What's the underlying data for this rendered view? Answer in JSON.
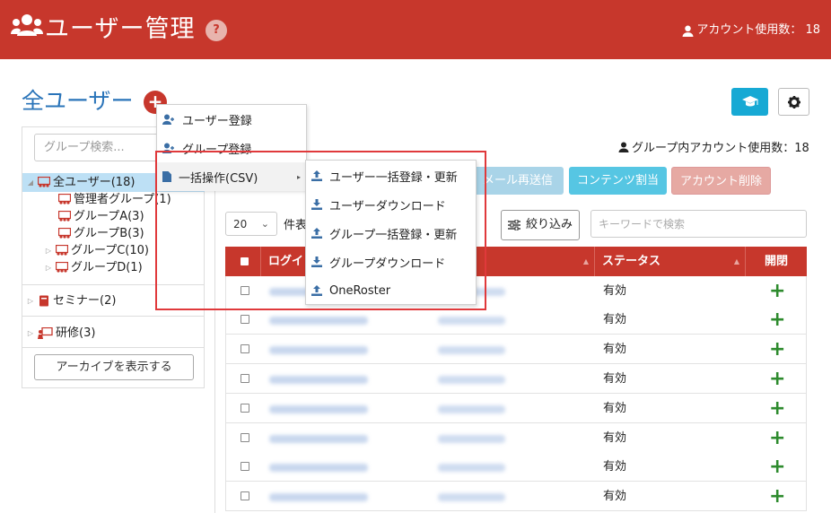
{
  "header": {
    "title": "ユーザー管理",
    "help": "?",
    "account_usage": "アカウント使用数： 18"
  },
  "page": {
    "title": "全ユーザー",
    "add": "+"
  },
  "sidebar": {
    "search_placeholder": "グループ検索...",
    "tree": [
      {
        "label": "全ユーザー(18)",
        "arrow": "◢",
        "selected": true
      },
      {
        "label": "管理者グループ(1)"
      },
      {
        "label": "グループA(3)"
      },
      {
        "label": "グループB(3)"
      },
      {
        "label": "グループC(10)",
        "arrow": "▷"
      },
      {
        "label": "グループD(1)",
        "arrow": "▷"
      }
    ],
    "seminar": "セミナー(2)",
    "training": "研修(3)",
    "archive_button": "アーカイブを表示する",
    "collapsed_arrow": "▷"
  },
  "main": {
    "group_account_usage": "グループ内アカウント使用数：18",
    "buttons": {
      "mail_resend": "メール再送信",
      "content_assign": "コンテンツ割当",
      "account_delete": "アカウント削除"
    },
    "per_page_value": "20",
    "per_page_label": "件表",
    "filter_button": "絞り込み",
    "keyword_placeholder": "キーワードで検索"
  },
  "table": {
    "headers": {
      "login": "ログイ",
      "status": "ステータス",
      "open": "開閉"
    },
    "rows": [
      {
        "status": "有効"
      },
      {
        "status": "有効"
      },
      {
        "status": "有効"
      },
      {
        "status": "有効"
      },
      {
        "status": "有効"
      },
      {
        "status": "有効"
      },
      {
        "status": "有効"
      },
      {
        "status": "有効"
      }
    ],
    "plus": "+"
  },
  "menu": {
    "items": [
      "ユーザー登録",
      "グループ登録",
      "一括操作(CSV)"
    ],
    "submenu_arrow": "▸",
    "csv_items": [
      "ユーザー一括登録・更新",
      "ユーザーダウンロード",
      "グループ一括登録・更新",
      "グループダウンロード",
      "OneRoster"
    ]
  },
  "colors": {
    "header": "#c7372c",
    "accent_blue": "#2a74b9",
    "selected": "#bde0f5",
    "highlight": "#e0393b"
  }
}
